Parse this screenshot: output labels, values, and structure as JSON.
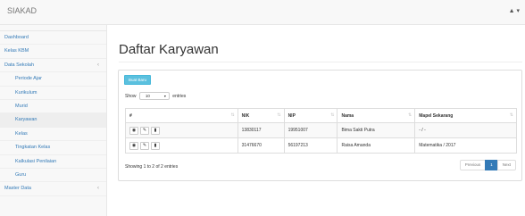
{
  "app": {
    "brand": "SIAKAD",
    "user_menu": "▲ ▾"
  },
  "sidebar": {
    "items": [
      {
        "label": "Dashboard",
        "level": 1,
        "active": false
      },
      {
        "label": "Kelas KBM",
        "level": 1,
        "active": false
      },
      {
        "label": "Data Sekolah",
        "level": 1,
        "active": false,
        "arrow": "‹"
      },
      {
        "label": "Periode Ajar",
        "level": 2,
        "active": false
      },
      {
        "label": "Kurikulum",
        "level": 2,
        "active": false
      },
      {
        "label": "Murid",
        "level": 2,
        "active": false
      },
      {
        "label": "Karyawan",
        "level": 2,
        "active": true
      },
      {
        "label": "Kelas",
        "level": 2,
        "active": false
      },
      {
        "label": "Tingkatan Kelas",
        "level": 2,
        "active": false
      },
      {
        "label": "Kalkulasi Penilaian",
        "level": 2,
        "active": false
      },
      {
        "label": "Guru",
        "level": 2,
        "active": false
      },
      {
        "label": "Master Data",
        "level": 1,
        "active": false,
        "arrow": "‹"
      }
    ]
  },
  "main": {
    "title": "Daftar Karyawan",
    "add_button": "Buat Baru",
    "length": {
      "show": "Show",
      "value": "10",
      "entries": "entries"
    },
    "table": {
      "headers": [
        "#",
        "NIK",
        "NIP",
        "Nama",
        "Mapel Sekarang"
      ],
      "rows": [
        {
          "nik": "13830117",
          "nip": "19951007",
          "nama": "Bima Sakti Putra",
          "mapel": "- / -"
        },
        {
          "nik": "31476670",
          "nip": "56197213",
          "nama": "Raisa Amanda",
          "mapel": "Matematika / 2017"
        }
      ]
    },
    "info": "Showing 1 to 2 of 2 entries",
    "pagination": {
      "prev": "Previous",
      "current": "1",
      "next": "Next"
    }
  },
  "colors": {
    "link": "#337ab7",
    "add_button": "#5bc0de",
    "active_page": "#337ab7"
  },
  "icons": {
    "view": "eye-icon",
    "edit": "pencil-icon",
    "delete": "trash-icon"
  }
}
